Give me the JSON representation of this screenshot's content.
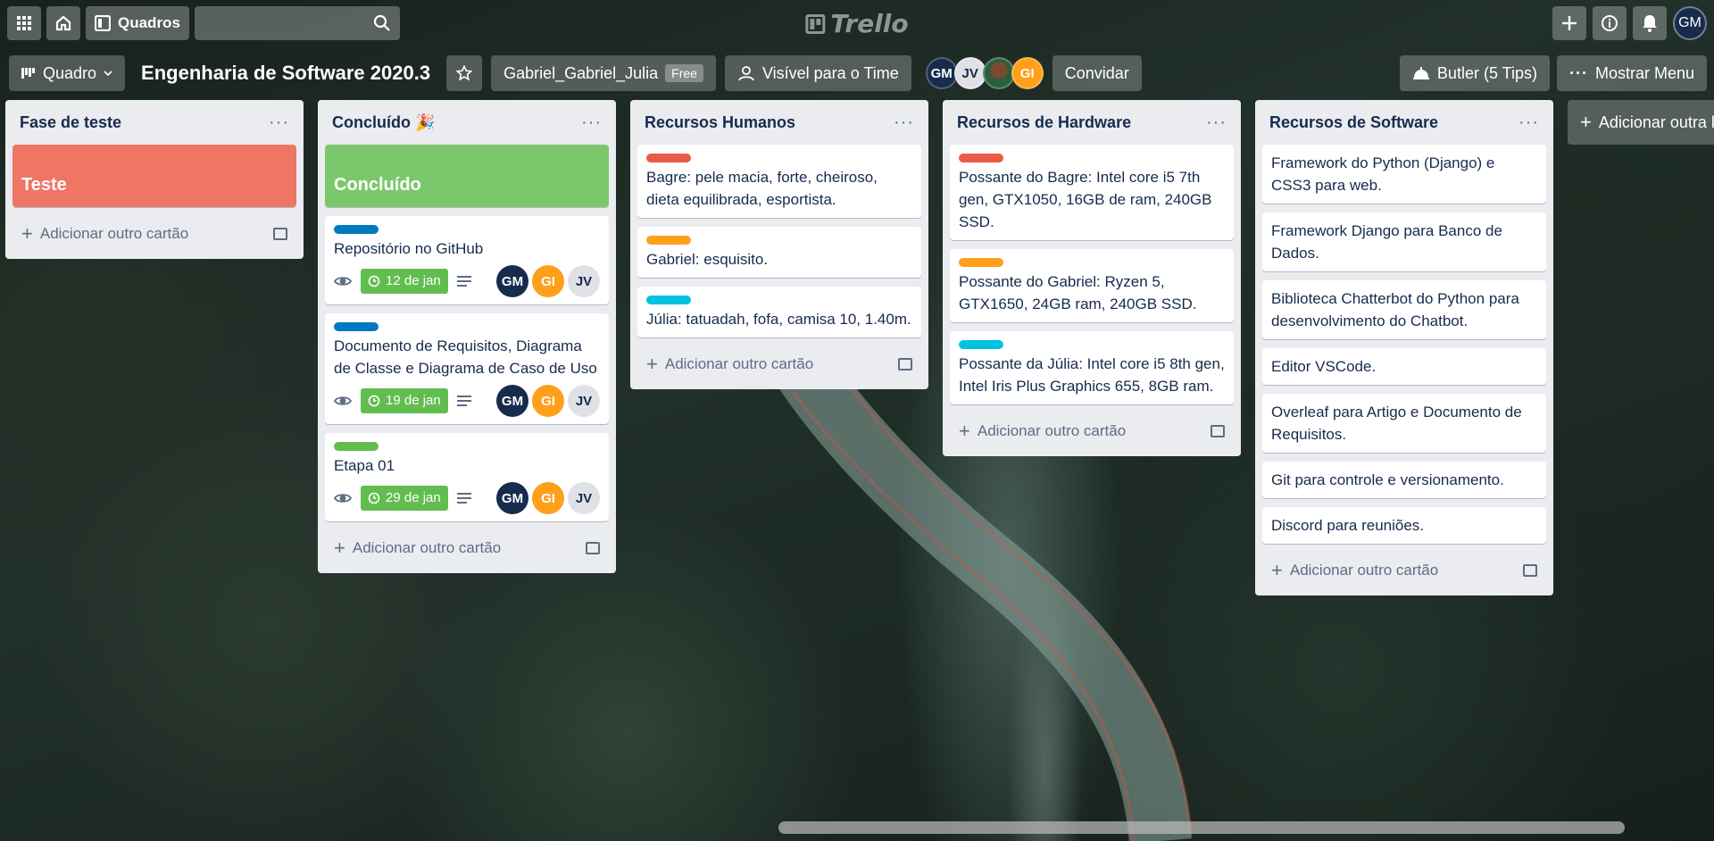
{
  "colors": {
    "label_red": "#eb5a46",
    "label_orange": "#ff9f1a",
    "label_blue": "#0079bf",
    "label_green": "#61bd4f",
    "label_sky": "#00c2e0",
    "cover_red": "#ef7564",
    "cover_green": "#7bc86c",
    "avatar_gm": "#172b4d",
    "avatar_gi": "#ff9f1a",
    "avatar_jv": "#dfe1e6"
  },
  "header": {
    "boards_label": "Quadros",
    "logo_text": "Trello",
    "me_initials": "GM"
  },
  "board": {
    "view_label": "Quadro",
    "title": "Engenharia de Software 2020.3",
    "team_name": "Gabriel_Gabriel_Julia",
    "plan": "Free",
    "visibility": "Visível para o Time",
    "members": [
      "GM",
      "JV",
      "",
      "GI"
    ],
    "invite": "Convidar",
    "butler": "Butler (5 Tips)",
    "show_menu": "Mostrar Menu"
  },
  "add_card_label": "Adicionar outro cartão",
  "add_list_label": "Adicionar outra lista",
  "lists": [
    {
      "title": "Fase de teste",
      "cover": {
        "text": "Teste",
        "color": "cover_red"
      }
    },
    {
      "title": "Concluído 🎉",
      "cover": {
        "text": "Concluído",
        "color": "cover_green"
      },
      "cards": [
        {
          "label": "label_blue",
          "text": "Repositório no GitHub",
          "due": "12 de jan",
          "members": [
            "GM",
            "GI",
            "JV"
          ]
        },
        {
          "label": "label_blue",
          "text": "Documento de Requisitos, Diagrama de Classe e Diagrama de Caso de Uso",
          "due": "19 de jan",
          "members": [
            "GM",
            "GI",
            "JV"
          ]
        },
        {
          "label": "label_green",
          "text": "Etapa 01",
          "due": "29 de jan",
          "members": [
            "GM",
            "GI",
            "JV"
          ]
        }
      ]
    },
    {
      "title": "Recursos Humanos",
      "cards": [
        {
          "label": "label_red",
          "text": "Bagre: pele macia, forte, cheiroso, dieta equilibrada, esportista."
        },
        {
          "label": "label_orange",
          "text": "Gabriel: esquisito."
        },
        {
          "label": "label_sky",
          "text": "Júlia: tatuadah, fofa, camisa 10, 1.40m."
        }
      ]
    },
    {
      "title": "Recursos de Hardware",
      "cards": [
        {
          "label": "label_red",
          "text": "Possante do Bagre: Intel core i5 7th gen, GTX1050, 16GB de ram, 240GB SSD."
        },
        {
          "label": "label_orange",
          "text": "Possante do Gabriel: Ryzen 5, GTX1650, 24GB ram, 240GB SSD."
        },
        {
          "label": "label_sky",
          "text": "Possante da Júlia: Intel core i5 8th gen, Intel Iris Plus Graphics 655, 8GB ram."
        }
      ]
    },
    {
      "title": "Recursos de Software",
      "cards": [
        {
          "text": "Framework do Python (Django) e CSS3 para web."
        },
        {
          "text": "Framework Django para Banco de Dados."
        },
        {
          "text": "Biblioteca Chatterbot do Python para desenvolvimento do Chatbot."
        },
        {
          "text": "Editor VSCode."
        },
        {
          "text": "Overleaf para Artigo e Documento de Requisitos."
        },
        {
          "text": "Git para controle e versionamento."
        },
        {
          "text": "Discord para reuniões."
        }
      ]
    }
  ]
}
